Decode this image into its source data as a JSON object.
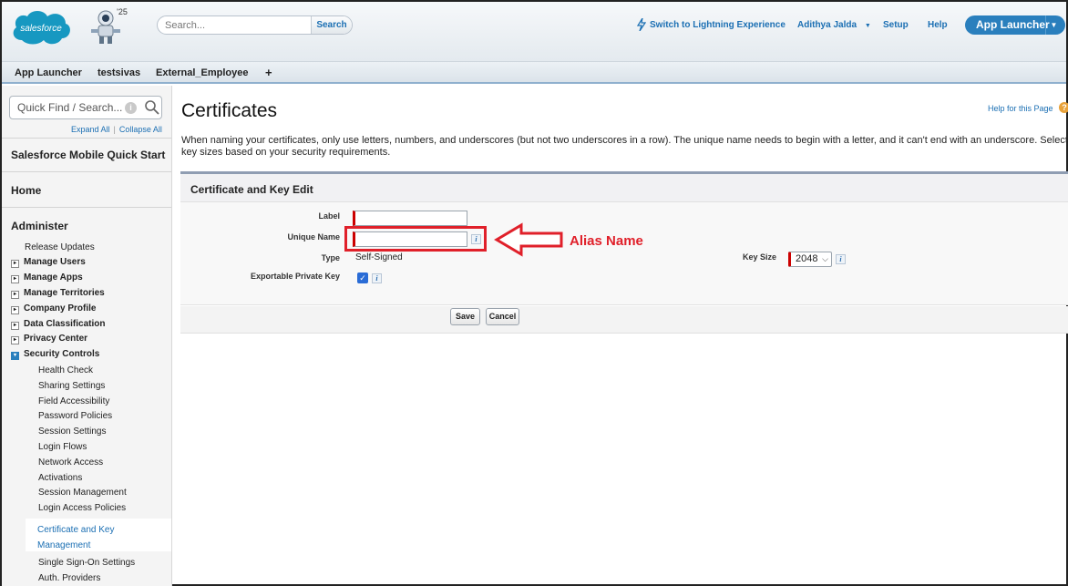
{
  "header": {
    "search_placeholder": "Search...",
    "search_button": "Search",
    "lightning_link": "Switch to Lightning Experience",
    "user_menu": "Adithya Jalda",
    "setup_link": "Setup",
    "help_link": "Help",
    "app_launcher": "App Launcher",
    "logo_text": "salesforce",
    "mascot_badge": "'25"
  },
  "tabs": [
    "App Launcher",
    "testsivas",
    "External_Employee",
    "+"
  ],
  "sidebar": {
    "quick_find_placeholder": "Quick Find / Search...",
    "expand_all": "Expand All",
    "collapse_all": "Collapse All",
    "quick_start": "Salesforce Mobile Quick Start",
    "home": "Home",
    "administer": "Administer",
    "release_updates": "Release Updates",
    "groups": [
      "Manage Users",
      "Manage Apps",
      "Manage Territories",
      "Company Profile",
      "Data Classification",
      "Privacy Center"
    ],
    "security_controls": "Security Controls",
    "security_items": [
      "Health Check",
      "Sharing Settings",
      "Field Accessibility",
      "Password Policies",
      "Session Settings",
      "Login Flows",
      "Network Access",
      "Activations",
      "Session Management",
      "Login Access Policies"
    ],
    "selected_item": "Certificate and Key Management",
    "after_items": [
      "Single Sign-On Settings",
      "Auth. Providers"
    ]
  },
  "main": {
    "title": "Certificates",
    "help_link": "Help for this Page",
    "description": "When naming your certificates, only use letters, numbers, and underscores (but not two underscores in a row). The unique name needs to begin with a letter, and it can't end with an underscore. Select key sizes based on your security requirements.",
    "panel_title": "Certificate and Key Edit",
    "label_label": "Label",
    "label_value": "",
    "unique_name_label": "Unique Name",
    "unique_name_value": "",
    "type_label": "Type",
    "type_value": "Self-Signed",
    "exportable_label": "Exportable Private Key",
    "exportable_checked": true,
    "key_size_label": "Key Size",
    "key_size_value": "2048",
    "save_button": "Save",
    "cancel_button": "Cancel"
  },
  "annotation": {
    "text": "Alias Name",
    "color": "#e0202a"
  },
  "colors": {
    "link": "#1b6fb3",
    "brand": "#2a7fbd",
    "required": "#cc0000"
  }
}
